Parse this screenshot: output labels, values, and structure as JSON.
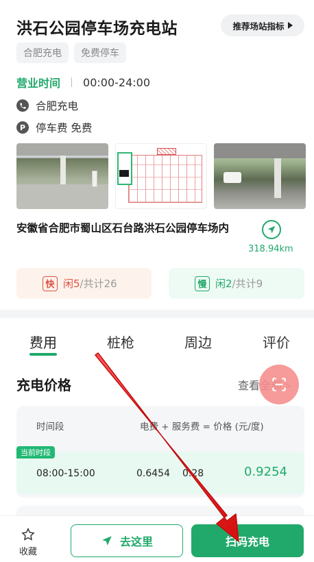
{
  "station": {
    "title": "洪石公园停车场充电站",
    "recommend_label": "推荐场站指标",
    "tags": [
      "合肥充电",
      "免费停车"
    ],
    "hours_label": "营业时间",
    "hours_value": "00:00-24:00",
    "operator": "合肥充电",
    "parking_icon_letter": "P",
    "parking_fee": "停车费  免费",
    "address": "安徽省合肥市蜀山区石台路洪石公园停车场内",
    "distance": "318.94km"
  },
  "ports": {
    "fast": {
      "badge": "快",
      "idle": "闲5",
      "total": "/共计26"
    },
    "slow": {
      "badge": "慢",
      "idle": "闲2",
      "total": "/共计9"
    }
  },
  "tabs": [
    "费用",
    "桩枪",
    "周边",
    "评价"
  ],
  "pricing": {
    "title": "充电价格",
    "view_all": "查看全部",
    "view_all_chevron": ">",
    "header_period": "时间段",
    "header_formula": "电费 + 服务费 = 价格 (元/度)",
    "current_badge": "当前时段",
    "current_row": {
      "period": "08:00-15:00",
      "electricity": "0.6454",
      "service": "0.28",
      "total": "0.9254"
    }
  },
  "bottom_bar": {
    "favorite_label": "收藏",
    "go_label": "去这里",
    "scan_label": "扫码充电"
  },
  "colors": {
    "brand_green": "#21a96b",
    "fast_red": "#e0503f",
    "annotation_arrow": "#e51b1b"
  }
}
